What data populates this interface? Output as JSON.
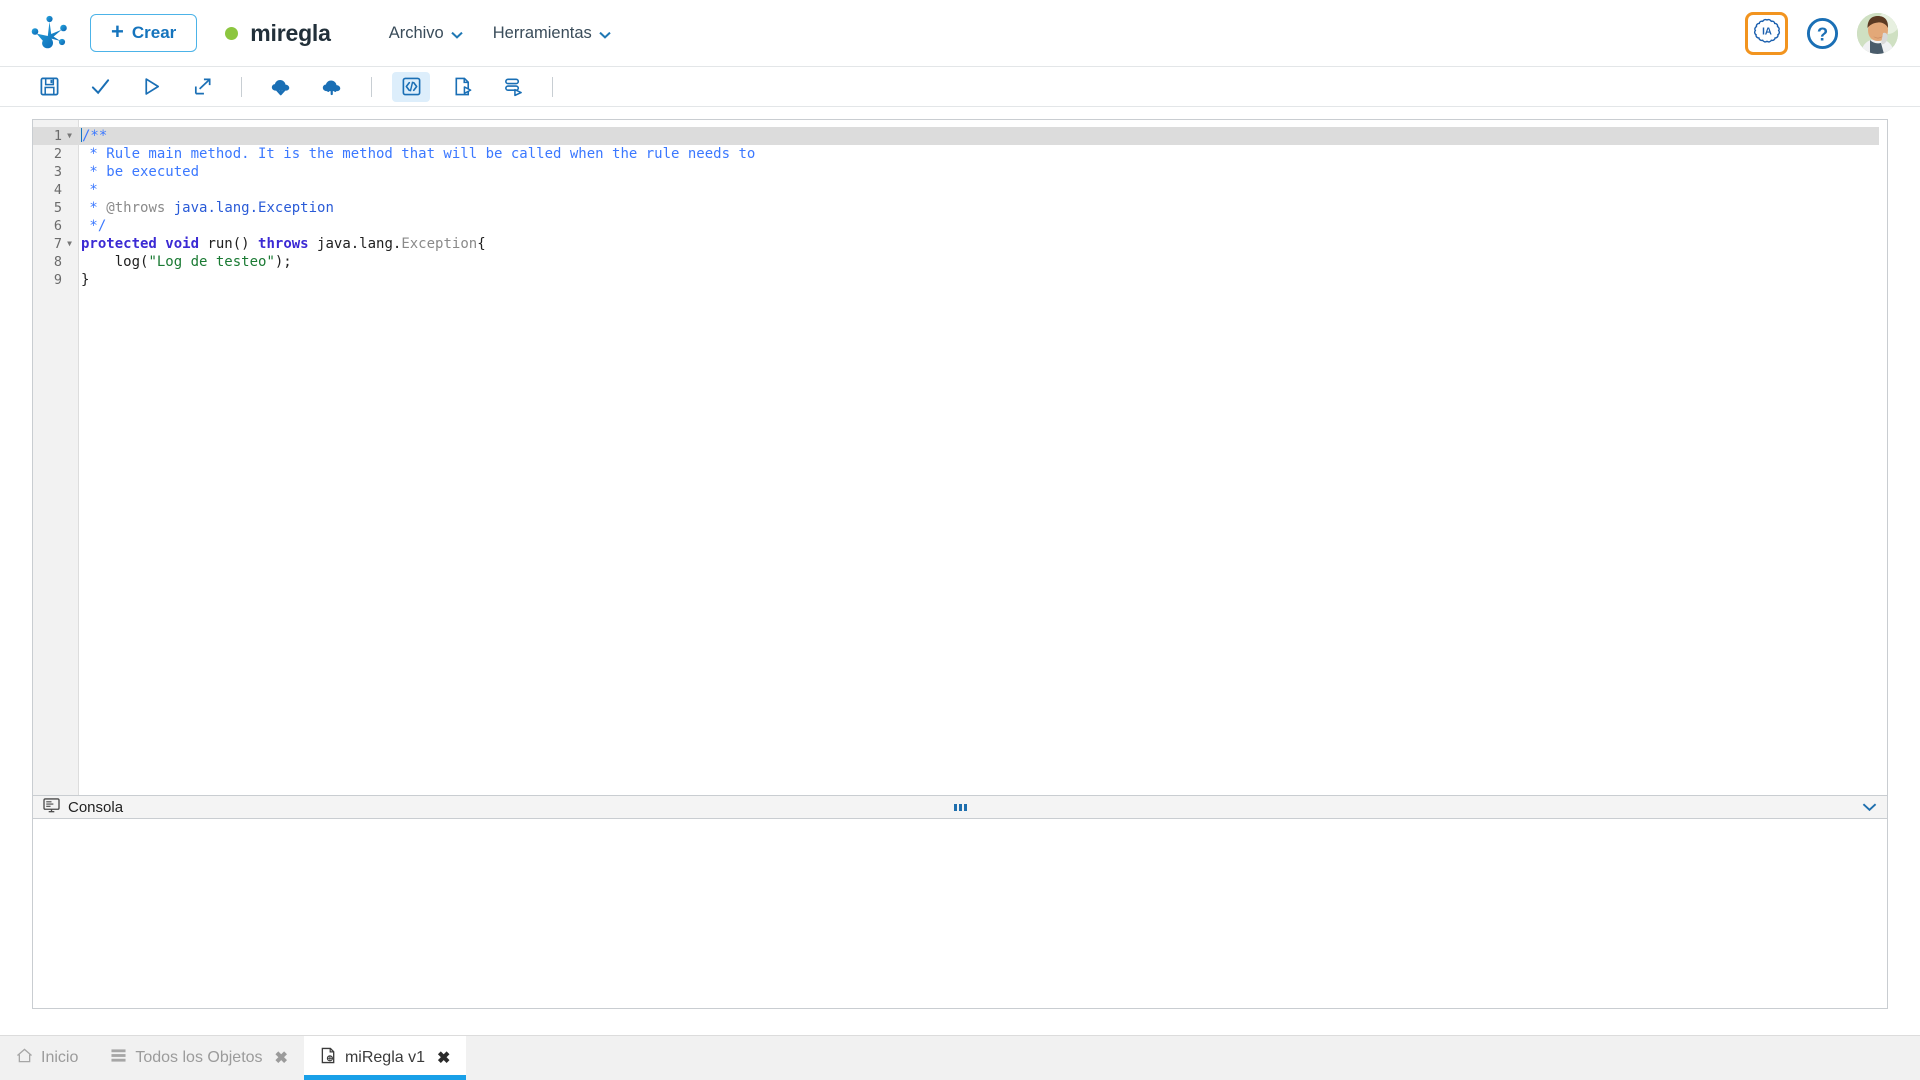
{
  "header": {
    "logo_icon": "frog-foot-logo",
    "create_label": "Crear",
    "create_icon": "plus-icon",
    "status_dot_color": "#8cc63f",
    "document_title": "miregla",
    "menus": [
      {
        "label": "Archivo",
        "caret": "⌄"
      },
      {
        "label": "Herramientas",
        "caret": "⌄"
      }
    ],
    "ia_badge_label": "IA",
    "ia_badge_border_color": "#f2941f",
    "help_icon": "question-circle-icon",
    "avatar_icon": "user-avatar"
  },
  "toolbar": {
    "items": [
      {
        "name": "save-icon",
        "title": "Guardar"
      },
      {
        "name": "validate-check-icon",
        "title": "Validar"
      },
      {
        "name": "run-play-icon",
        "title": "Ejecutar"
      },
      {
        "name": "export-arrow-icon",
        "title": "Exportar"
      },
      {
        "name": "separator-1",
        "title": ""
      },
      {
        "name": "cloud-download-icon",
        "title": "Descargar"
      },
      {
        "name": "cloud-upload-icon",
        "title": "Subir"
      },
      {
        "name": "separator-2",
        "title": ""
      },
      {
        "name": "code-view-icon",
        "title": "Codigo"
      },
      {
        "name": "file-run-icon",
        "title": "Ejecutar archivo"
      },
      {
        "name": "stack-run-icon",
        "title": "Ejecutar lote"
      },
      {
        "name": "separator-3",
        "title": ""
      }
    ]
  },
  "editor": {
    "accent_color": "#1575c0",
    "active_line": 1,
    "lines": [
      {
        "n": 1,
        "fold": true,
        "tokens": [
          {
            "t": "/**",
            "c": "tok-cmt"
          }
        ]
      },
      {
        "n": 2,
        "fold": false,
        "tokens": [
          {
            "t": " * Rule main method. It is the method that will be called when the rule needs to",
            "c": "tok-cmt"
          }
        ]
      },
      {
        "n": 3,
        "fold": false,
        "tokens": [
          {
            "t": " * be executed",
            "c": "tok-cmt"
          }
        ]
      },
      {
        "n": 4,
        "fold": false,
        "tokens": [
          {
            "t": " *",
            "c": "tok-cmt"
          }
        ]
      },
      {
        "n": 5,
        "fold": false,
        "tokens": [
          {
            "t": " * ",
            "c": "tok-cmt"
          },
          {
            "t": "@throws",
            "c": "tok-tag"
          },
          {
            "t": " ",
            "c": "tok-cmt"
          },
          {
            "t": "java.lang.Exception",
            "c": "tok-type"
          }
        ]
      },
      {
        "n": 6,
        "fold": false,
        "tokens": [
          {
            "t": " */",
            "c": "tok-cmt"
          }
        ]
      },
      {
        "n": 7,
        "fold": true,
        "tokens": [
          {
            "t": "protected",
            "c": "tok-kw"
          },
          {
            "t": " ",
            "c": "tok-plain"
          },
          {
            "t": "void",
            "c": "tok-kw"
          },
          {
            "t": " run() ",
            "c": "tok-plain"
          },
          {
            "t": "throws",
            "c": "tok-kw"
          },
          {
            "t": " java.lang.",
            "c": "tok-plain"
          },
          {
            "t": "Exception",
            "c": "tok-dim"
          },
          {
            "t": "{",
            "c": "tok-plain"
          }
        ]
      },
      {
        "n": 8,
        "fold": false,
        "tokens": [
          {
            "t": "    log(",
            "c": "tok-plain"
          },
          {
            "t": "\"Log de testeo\"",
            "c": "tok-str"
          },
          {
            "t": ");",
            "c": "tok-plain"
          }
        ]
      },
      {
        "n": 9,
        "fold": false,
        "tokens": [
          {
            "t": "}",
            "c": "tok-plain"
          }
        ]
      }
    ]
  },
  "console": {
    "label": "Consola",
    "icon": "console-monitor-icon",
    "drag_handle_icon": "drag-dots-icon",
    "collapse_icon": "chevron-down-icon",
    "output": ""
  },
  "tabs": [
    {
      "label": "Inicio",
      "icon": "home-icon",
      "closable": false,
      "active": false
    },
    {
      "label": "Todos los Objetos",
      "icon": "list-icon",
      "closable": true,
      "active": false
    },
    {
      "label": "miRegla v1",
      "icon": "rule-file-icon",
      "closable": true,
      "active": true
    }
  ],
  "tab_close_glyph": "✖"
}
